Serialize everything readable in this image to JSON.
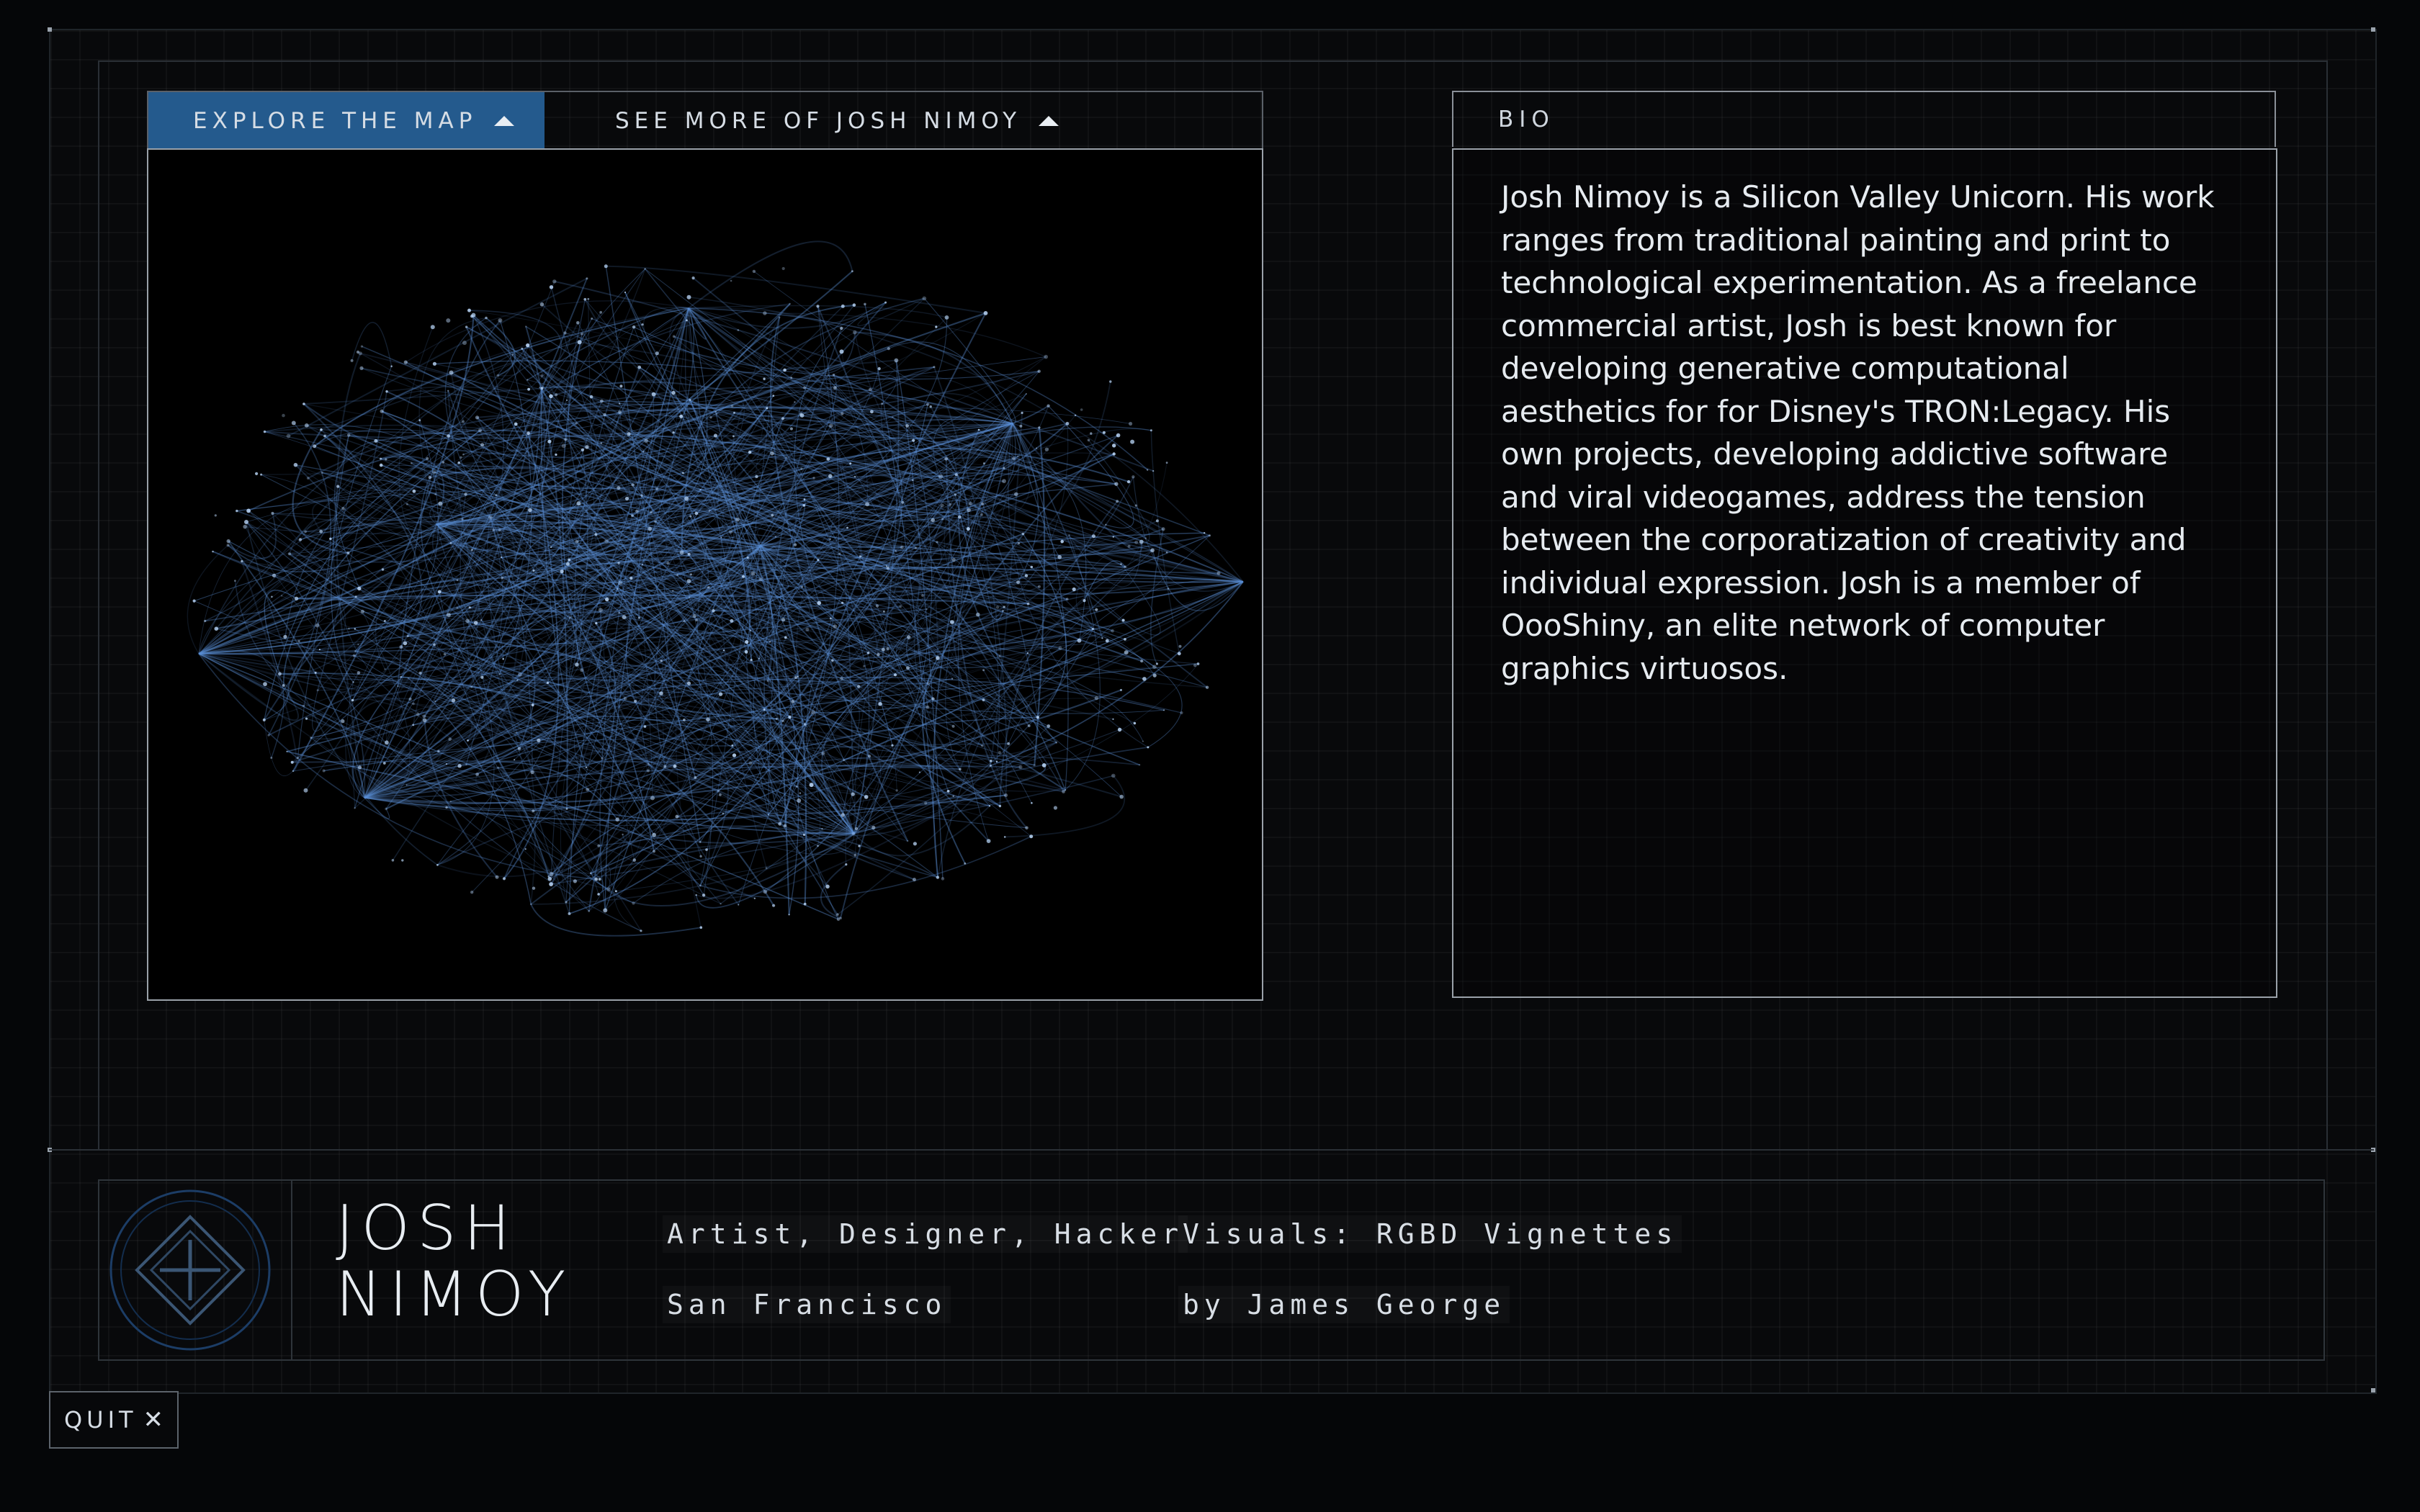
{
  "tabs": {
    "explore_label": "EXPLORE THE MAP",
    "more_label": "SEE MORE OF JOSH NIMOY"
  },
  "bio": {
    "heading": "BIO",
    "text": "Josh Nimoy is a Silicon Valley Unicorn. His work ranges from traditional painting and print to technological experimentation. As a freelance commercial artist, Josh is best known for developing generative computational aesthetics for for Disney's TRON:Legacy. His own projects, developing addictive software and viral videogames, address the tension between the corporatization of creativity and individual expression. Josh is a member of OooShiny, an elite network of computer graphics virtuosos."
  },
  "profile": {
    "first_name": "JOSH",
    "last_name": "NIMOY",
    "roles": "Artist, Designer, Hacker",
    "location": "San Francisco",
    "visuals": "Visuals: RGBD Vignettes",
    "credit": "by James George"
  },
  "controls": {
    "quit_label": "QUIT"
  },
  "colors": {
    "accent": "#245a8d",
    "network": "#5b8fd6"
  },
  "icons": {
    "logo": "diamond-logo-icon",
    "expand": "triangle-up-icon",
    "close": "close-icon"
  }
}
